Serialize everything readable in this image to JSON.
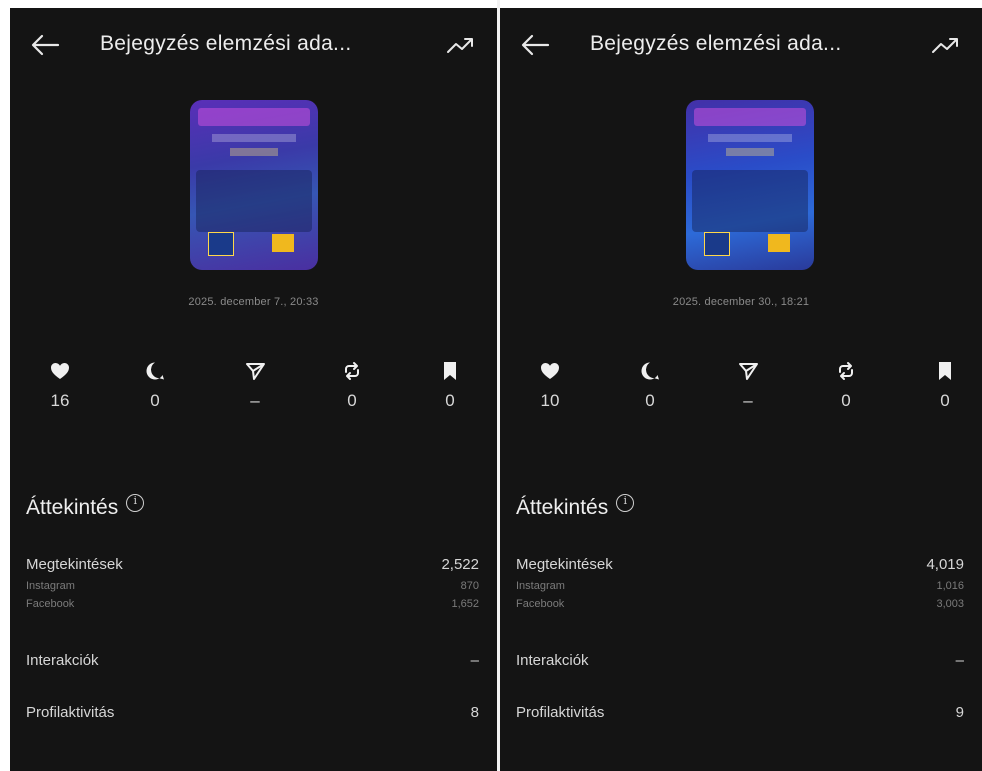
{
  "panels": [
    {
      "title": "Bejegyzés elemzési ada...",
      "date": "2025. december 7., 20:33",
      "stats": {
        "likes": "16",
        "comments": "0",
        "shares": "–",
        "reposts": "0",
        "saves": "0"
      },
      "overview_title": "Áttekintés",
      "views_label": "Megtekintések",
      "views_value": "2,522",
      "instagram_label": "Instagram",
      "instagram_value": "870",
      "facebook_label": "Facebook",
      "facebook_value": "1,652",
      "interactions_label": "Interakciók",
      "interactions_value": "–",
      "profile_label": "Profilaktivitás",
      "profile_value": "8"
    },
    {
      "title": "Bejegyzés elemzési ada...",
      "date": "2025. december 30., 18:21",
      "stats": {
        "likes": "10",
        "comments": "0",
        "shares": "–",
        "reposts": "0",
        "saves": "0"
      },
      "overview_title": "Áttekintés",
      "views_label": "Megtekintések",
      "views_value": "4,019",
      "instagram_label": "Instagram",
      "instagram_value": "1,016",
      "facebook_label": "Facebook",
      "facebook_value": "3,003",
      "interactions_label": "Interakciók",
      "interactions_value": "–",
      "profile_label": "Profilaktivitás",
      "profile_value": "9"
    }
  ],
  "icons": {
    "back": "back-arrow-icon",
    "trend": "trending-up-icon",
    "likes": "heart-icon",
    "comments": "comment-icon",
    "shares": "send-icon",
    "reposts": "repost-icon",
    "saves": "bookmark-icon",
    "info": "info-icon"
  },
  "colors": {
    "background": "#141414",
    "text": "#e8e8e8",
    "muted": "#7b7b7b"
  }
}
